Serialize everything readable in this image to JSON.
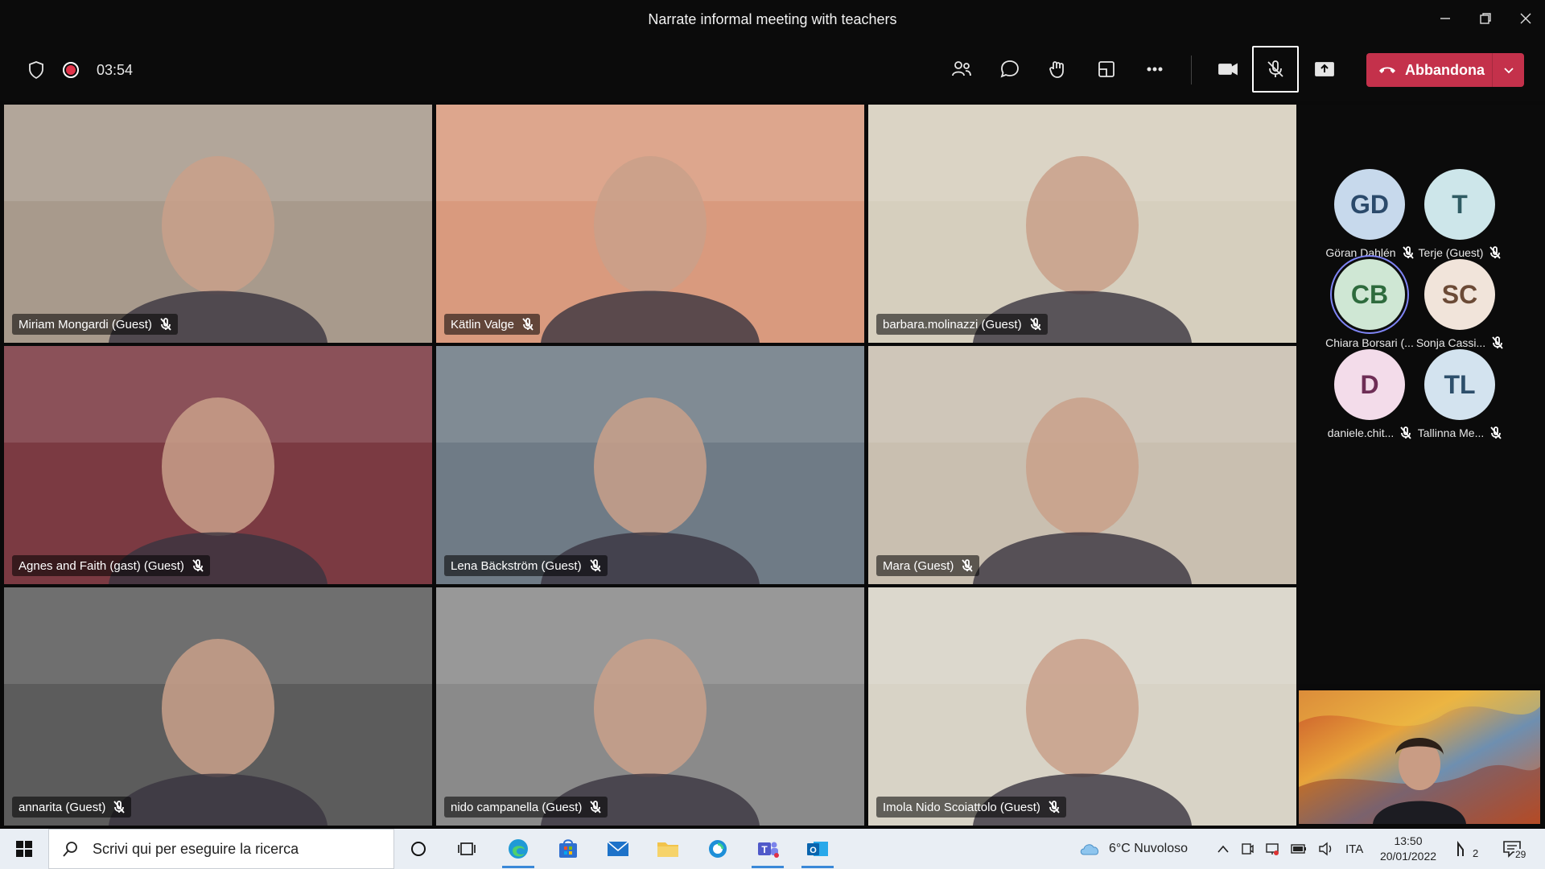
{
  "window": {
    "title": "Narrate informal meeting with teachers"
  },
  "toolbar": {
    "timer": "03:54",
    "leave_label": "Abbandona"
  },
  "tiles": [
    {
      "name": "Miriam Mongardi (Guest)",
      "bg": "#a89a8c"
    },
    {
      "name": "Kätlin Valge",
      "bg": "#d99a7e"
    },
    {
      "name": "barbara.molinazzi (Guest)",
      "bg": "#d6cfbe"
    },
    {
      "name": "Agnes and Faith (gast) (Guest)",
      "bg": "#7b3a42"
    },
    {
      "name": "Lena Bäckström (Guest)",
      "bg": "#6f7b86"
    },
    {
      "name": "Mara (Guest)",
      "bg": "#c9bfb0"
    },
    {
      "name": "annarita (Guest)",
      "bg": "#5c5c5c"
    },
    {
      "name": "nido campanella (Guest)",
      "bg": "#8a8a8a"
    },
    {
      "name": "Imola Nido Scoiattolo (Guest)",
      "bg": "#d8d3c6"
    }
  ],
  "roster": [
    {
      "initials": "GD",
      "name": "Göran Dahlén",
      "bg": "#c7d9ec",
      "fg": "#2b4a6b"
    },
    {
      "initials": "T",
      "name": "Terje (Guest)",
      "bg": "#cde6ea",
      "fg": "#2f5b63"
    },
    {
      "initials": "CB",
      "name": "Chiara Borsari (...",
      "bg": "#cfe7d4",
      "fg": "#2e6b3d"
    },
    {
      "initials": "SC",
      "name": "Sonja Cassi...",
      "bg": "#f1e4da",
      "fg": "#6b4a36"
    },
    {
      "initials": "D",
      "name": "daniele.chit...",
      "bg": "#f3dcea",
      "fg": "#6e2e56"
    },
    {
      "initials": "TL",
      "name": "Tallinna Me...",
      "bg": "#d3e3ef",
      "fg": "#2d4f6b"
    }
  ],
  "taskbar": {
    "search_placeholder": "Scrivi qui per eseguire la ricerca",
    "weather": "6°C  Nuvoloso",
    "language": "ITA",
    "time": "13:50",
    "date": "20/01/2022",
    "notif_count": "29",
    "people_count": "2"
  }
}
